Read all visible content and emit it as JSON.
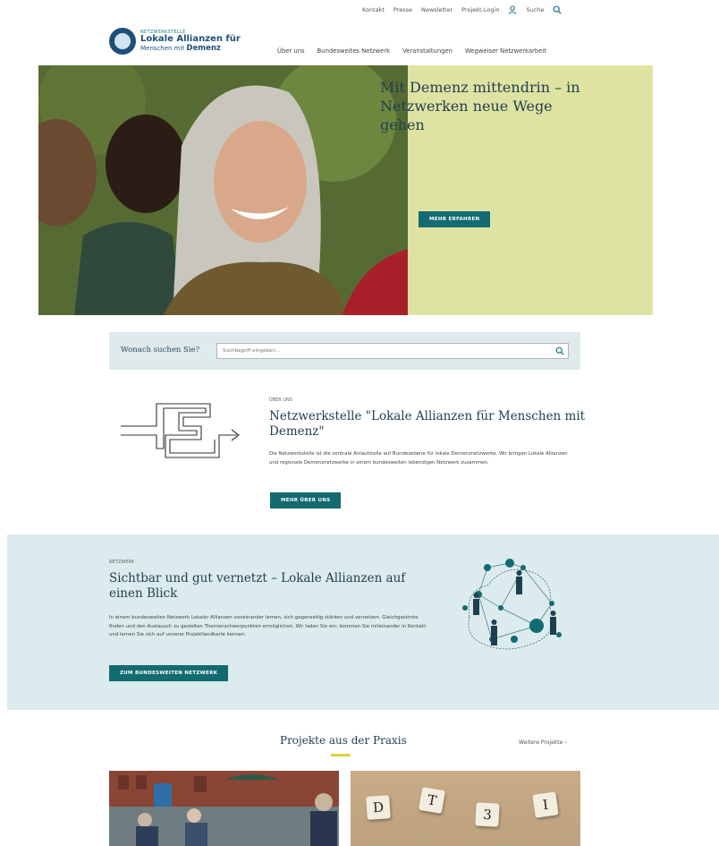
{
  "utility_nav": {
    "kontakt": "Kontakt",
    "presse": "Presse",
    "newsletter": "Newsletter",
    "login": "Projekt-Login",
    "suche": "Suche"
  },
  "logo": {
    "kicker": "NETZWERKSTELLE",
    "line1": "Lokale Allianzen für",
    "line2_prefix": "Menschen mit ",
    "line2_bold": "Demenz"
  },
  "main_nav": [
    "Über uns",
    "Bundesweites Netzwerk",
    "Veranstaltungen",
    "Wegweiser Netzwerkarbeit"
  ],
  "hero": {
    "title": "Mit Demenz mittendrin – in Netzwerken neue Wege gehen",
    "button": "MEHR ERFAHREN"
  },
  "search": {
    "label": "Wonach suchen Sie?",
    "placeholder": "Suchbegriff eingeben..."
  },
  "about": {
    "kicker": "ÜBER UNS",
    "title": "Netzwerkstelle \"Lokale Allianzen für Menschen mit Demenz\"",
    "body": "Die Netzwerkstelle ist die zentrale Anlaufstelle auf Bundesebene für lokale Demenznetzwerke. Wir bringen Lokale Allianzen und regionale Demenznetzwerke in einem bundesweiten lebendigen Netzwerk zusammen.",
    "button": "MEHR ÜBER UNS"
  },
  "network": {
    "kicker": "NETZWERK",
    "title": "Sichtbar und gut vernetzt – Lokale Allianzen auf einen Blick",
    "body": "In einem bundesweiten Netzwerk Lokaler Allianzen voneinander lernen, sich gegenseitig stärken und vernetzen. Gleichgesinnte finden und den Austausch zu gezielten Themenschwerpunkten ermöglichen. Wir laden Sie ein: kommen Sie miteinander in Kontakt und lernen Sie sich auf unserer Projektlandkarte kennen.",
    "button": "ZUM BUNDESWEITEN NETZWERK"
  },
  "projects": {
    "title": "Projekte aus der Praxis",
    "more": "Weitere Projekte",
    "tiles": [
      "D",
      "T",
      "3",
      "I"
    ]
  },
  "colors": {
    "teal": "#136b71",
    "hero_panel": "#dfe3a2",
    "network_bg": "#dcebed",
    "search_bg": "#deeaec",
    "accent_yellow": "#d8d23a"
  }
}
